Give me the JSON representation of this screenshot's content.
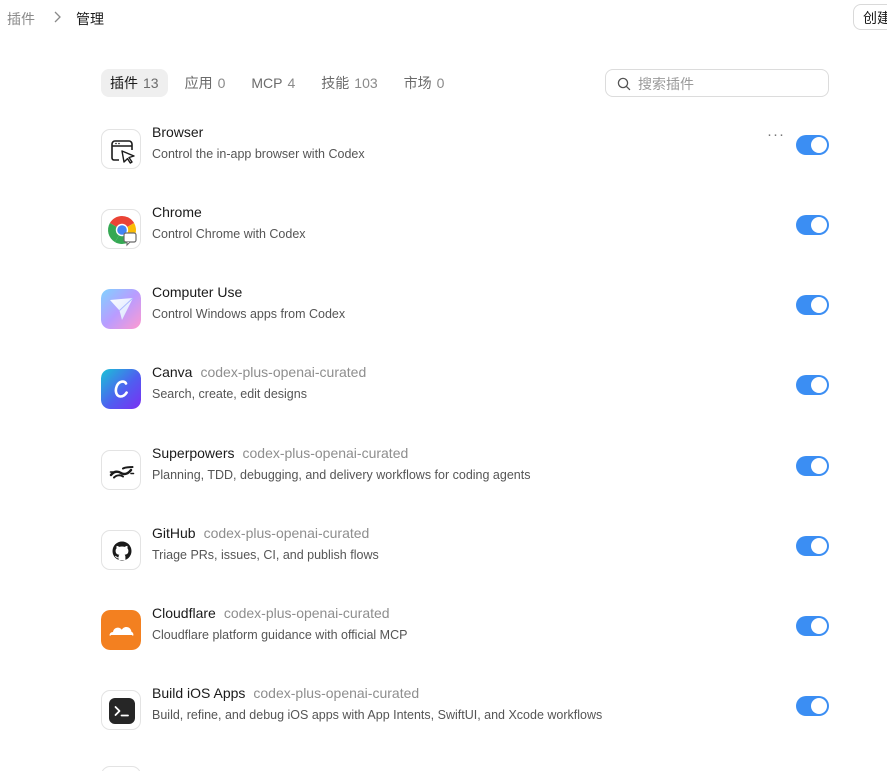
{
  "breadcrumb": {
    "root": "插件",
    "current": "管理"
  },
  "header": {
    "create_label": "创建"
  },
  "tabs": [
    {
      "label": "插件",
      "count": "13",
      "active": true
    },
    {
      "label": "应用",
      "count": "0",
      "active": false
    },
    {
      "label": "MCP",
      "count": "4",
      "active": false
    },
    {
      "label": "技能",
      "count": "103",
      "active": false
    },
    {
      "label": "市场",
      "count": "0",
      "active": false
    }
  ],
  "search": {
    "placeholder": "搜索插件",
    "value": ""
  },
  "accent_color": "#3b8ef3",
  "plugins": [
    {
      "name": "Browser",
      "source": "",
      "description": "Control the in-app browser with Codex",
      "icon": "browser-cursor-icon",
      "enabled": true,
      "has_more_menu": true
    },
    {
      "name": "Chrome",
      "source": "",
      "description": "Control Chrome with Codex",
      "icon": "chrome-icon",
      "enabled": true
    },
    {
      "name": "Computer Use",
      "source": "",
      "description": "Control Windows apps from Codex",
      "icon": "computer-use-icon",
      "enabled": true
    },
    {
      "name": "Canva",
      "source": "codex-plus-openai-curated",
      "description": "Search, create, edit designs",
      "icon": "canva-icon",
      "enabled": true
    },
    {
      "name": "Superpowers",
      "source": "codex-plus-openai-curated",
      "description": "Planning, TDD, debugging, and delivery workflows for coding agents",
      "icon": "superpowers-icon",
      "enabled": true
    },
    {
      "name": "GitHub",
      "source": "codex-plus-openai-curated",
      "description": "Triage PRs, issues, CI, and publish flows",
      "icon": "github-icon",
      "enabled": true
    },
    {
      "name": "Cloudflare",
      "source": "codex-plus-openai-curated",
      "description": "Cloudflare platform guidance with official MCP",
      "icon": "cloudflare-icon",
      "enabled": true
    },
    {
      "name": "Build iOS Apps",
      "source": "codex-plus-openai-curated",
      "description": "Build, refine, and debug iOS apps with App Intents, SwiftUI, and Xcode workflows",
      "icon": "terminal-icon",
      "enabled": true
    }
  ]
}
